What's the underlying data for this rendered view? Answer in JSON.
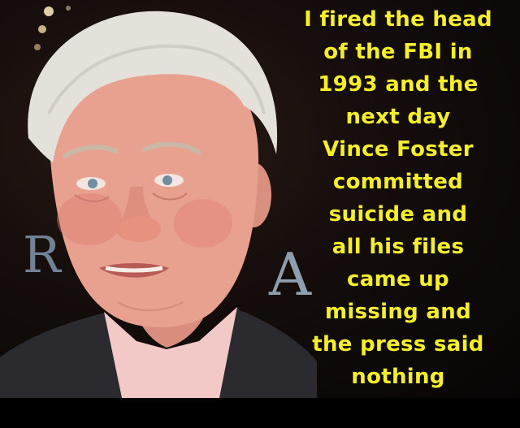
{
  "image": {
    "backdrop_letters": {
      "left": "R",
      "right": "A"
    },
    "colors": {
      "quote_text": "#f5ee2b",
      "background": "#0b0b0b",
      "suit": "#2b2a2e",
      "shirt": "#f2c9c6",
      "hair": "#e4e1db",
      "skin": "#e8a08f"
    },
    "quote_lines": [
      "I fired the head",
      "of the FBI in",
      "1993 and the",
      "next day",
      "Vince Foster",
      "committed",
      "suicide and",
      "all his files",
      "came up",
      "missing and",
      "the press said",
      "nothing"
    ]
  }
}
